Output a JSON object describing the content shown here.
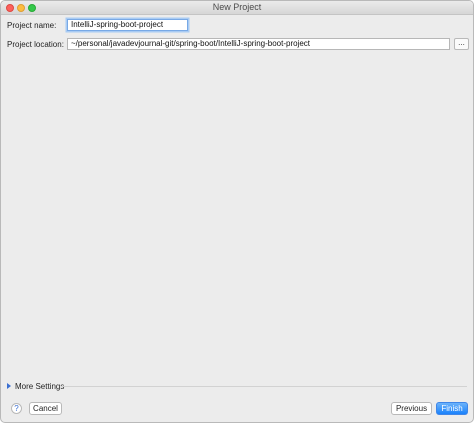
{
  "window": {
    "title": "New Project"
  },
  "form": {
    "name_label": "Project name:",
    "name_value": "IntelliJ-spring-boot-project",
    "location_label": "Project location:",
    "location_value": "~/personal/javadevjournal-git/spring-boot/IntelliJ-spring-boot-project",
    "browse_label": "..."
  },
  "more_settings": {
    "label": "More Settings"
  },
  "footer": {
    "help_label": "?",
    "cancel_label": "Cancel",
    "previous_label": "Previous",
    "finish_label": "Finish"
  },
  "colors": {
    "accent": "#1a82fb",
    "focus_ring": "#a9cbf3"
  }
}
